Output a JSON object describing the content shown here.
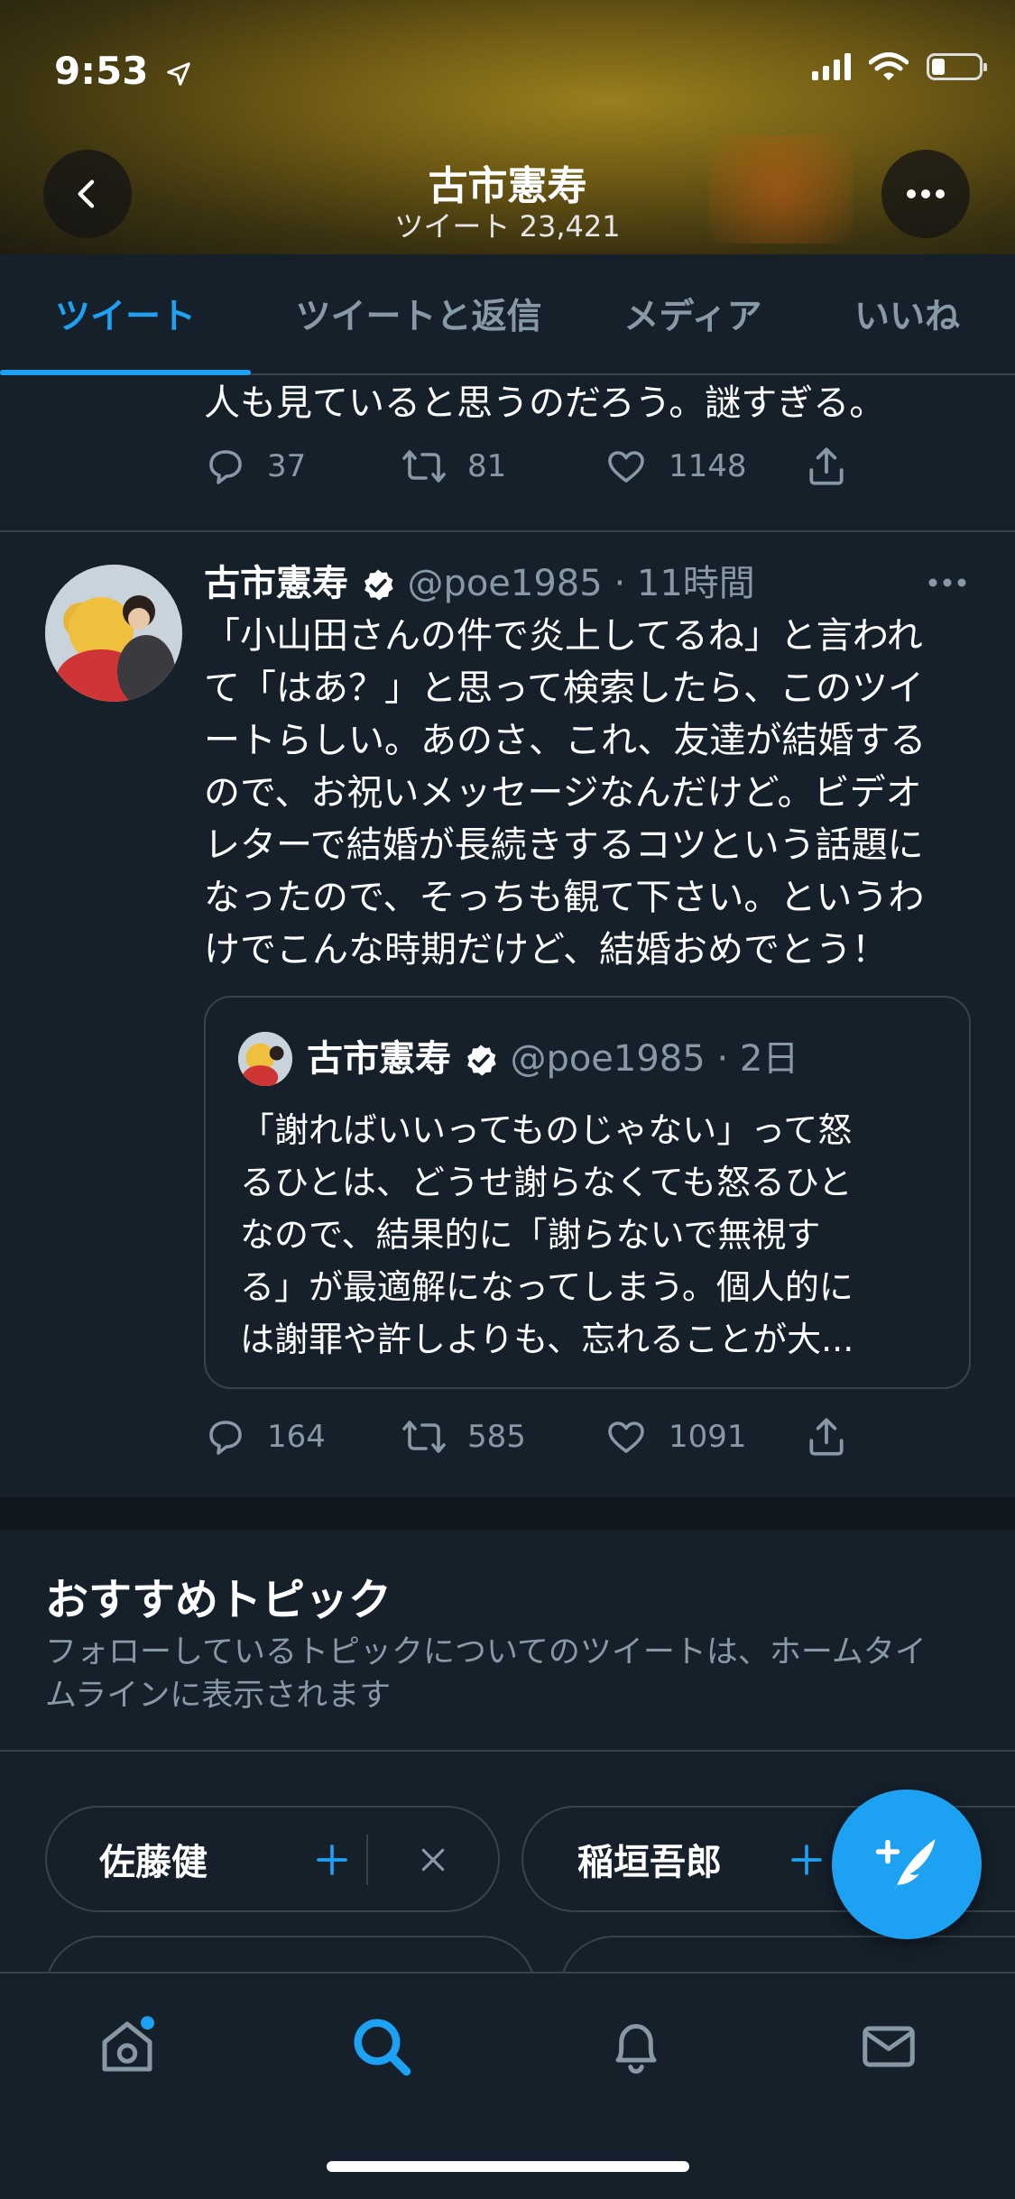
{
  "status_bar": {
    "time": "9:53"
  },
  "header": {
    "title": "古市憲寿",
    "subtitle": "ツイート 23,421"
  },
  "tabs": [
    {
      "label": "ツイート",
      "active": true
    },
    {
      "label": "ツイートと返信",
      "active": false
    },
    {
      "label": "メディア",
      "active": false
    },
    {
      "label": "いいね",
      "active": false
    }
  ],
  "prev_tweet": {
    "text_tail": "人も見ていると思うのだろう。謎すぎる。",
    "replies": "37",
    "retweets": "81",
    "likes": "1148"
  },
  "tweet": {
    "name": "古市憲寿",
    "handle": "@poe1985",
    "time": "· 11時間",
    "lines": [
      "「小山田さんの件で炎上してるね」と言われ",
      "て「はあ？」と思って検索したら、このツイ",
      "ートらしい。あのさ、これ、友達が結婚する",
      "ので、お祝いメッセージなんだけど。ビデオ",
      "レターで結婚が長続きするコツという話題に",
      "なったので、そっちも観て下さい。というわ",
      "けでこんな時期だけど、結婚おめでとう！"
    ],
    "quote": {
      "name": "古市憲寿",
      "handle": "@poe1985",
      "time": "· 2日",
      "lines": [
        "「謝ればいいってものじゃない」って怒",
        "るひとは、どうせ謝らなくても怒るひと",
        "なので、結果的に「謝らないで無視す",
        "る」が最適解になってしまう。個人的に",
        "は謝罪や許しよりも、忘れることが大..."
      ]
    },
    "replies": "164",
    "retweets": "585",
    "likes": "1091"
  },
  "topics": {
    "title": "おすすめトピック",
    "description_lines": [
      "フォローしているトピックについてのツイートは、ホームタイ",
      "ムラインに表示されます"
    ],
    "items": [
      {
        "label": "佐藤健"
      },
      {
        "label": "稲垣吾郎"
      }
    ]
  },
  "colors": {
    "accent": "#1da1f2",
    "background": "#15202b",
    "muted": "#8899a6",
    "border": "#38444d"
  },
  "icons": [
    "location-arrow-icon",
    "signal-icon",
    "wifi-icon",
    "battery-icon",
    "back-arrow-icon",
    "more-icon",
    "reply-icon",
    "retweet-icon",
    "like-icon",
    "share-icon",
    "verified-icon",
    "plus-icon",
    "close-icon",
    "compose-icon",
    "home-icon",
    "search-icon",
    "bell-icon",
    "mail-icon"
  ]
}
